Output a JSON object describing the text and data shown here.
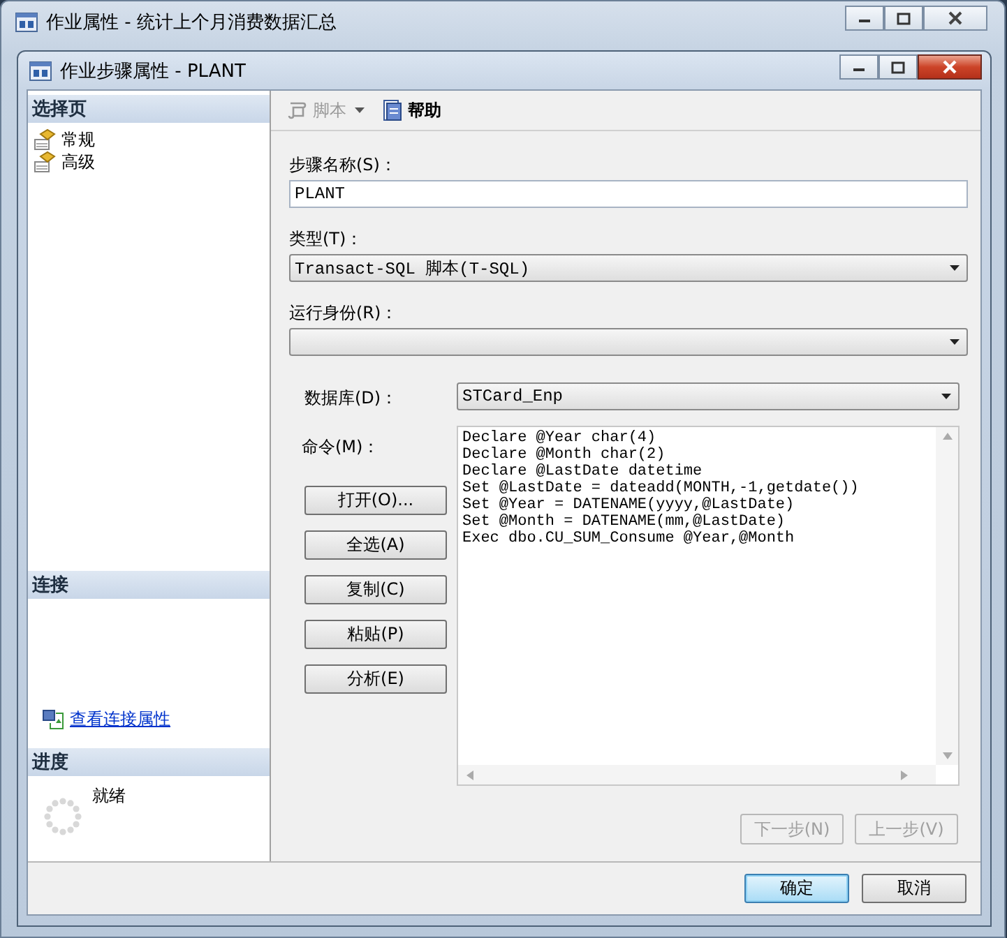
{
  "background_window": {
    "title": "作业属性 - 统计上个月消费数据汇总"
  },
  "dialog": {
    "title": "作业步骤属性 - PLANT"
  },
  "sidebar": {
    "header": "选择页",
    "items": [
      {
        "label": "常规",
        "selected": false
      },
      {
        "label": "高级",
        "selected": false
      }
    ]
  },
  "connection": {
    "header": "连接",
    "link": "查看连接属性"
  },
  "progress": {
    "header": "进度",
    "status": "就绪"
  },
  "toolbar": [
    {
      "label": "脚本",
      "kind": "dropdown",
      "disabled": true
    },
    {
      "label": "帮助",
      "kind": "help",
      "disabled": false
    }
  ],
  "form": {
    "step_name": {
      "label": "步骤名称(S)：",
      "value": "PLANT"
    },
    "type": {
      "label": "类型(T)：",
      "value": "Transact-SQL 脚本(T-SQL)"
    },
    "run_as": {
      "label": "运行身份(R)："
    },
    "database": {
      "label": "数据库(D)：",
      "value": "STCard_Enp"
    },
    "command": {
      "label": "命令(M)：",
      "lines": [
        "Declare @Year char(4)",
        "Declare @Month char(2)",
        "Declare @LastDate datetime",
        "Set @LastDate = dateadd(MONTH,-1,getdate())",
        "Set @Year = DATENAME(yyyy,@LastDate)",
        "Set @Month = DATENAME(mm,@LastDate)",
        "Exec dbo.CU_SUM_Consume @Year,@Month"
      ]
    }
  },
  "command_buttons": [
    "打开(O)...",
    "全选(A)",
    "复制(C)",
    "粘贴(P)",
    "分析(E)"
  ],
  "nav_buttons": [
    {
      "label": "下一步(N)",
      "disabled": true
    },
    {
      "label": "上一步(V)",
      "disabled": true
    }
  ],
  "footer_buttons": [
    {
      "label": "确定",
      "default": true
    },
    {
      "label": "取消",
      "default": false
    }
  ]
}
